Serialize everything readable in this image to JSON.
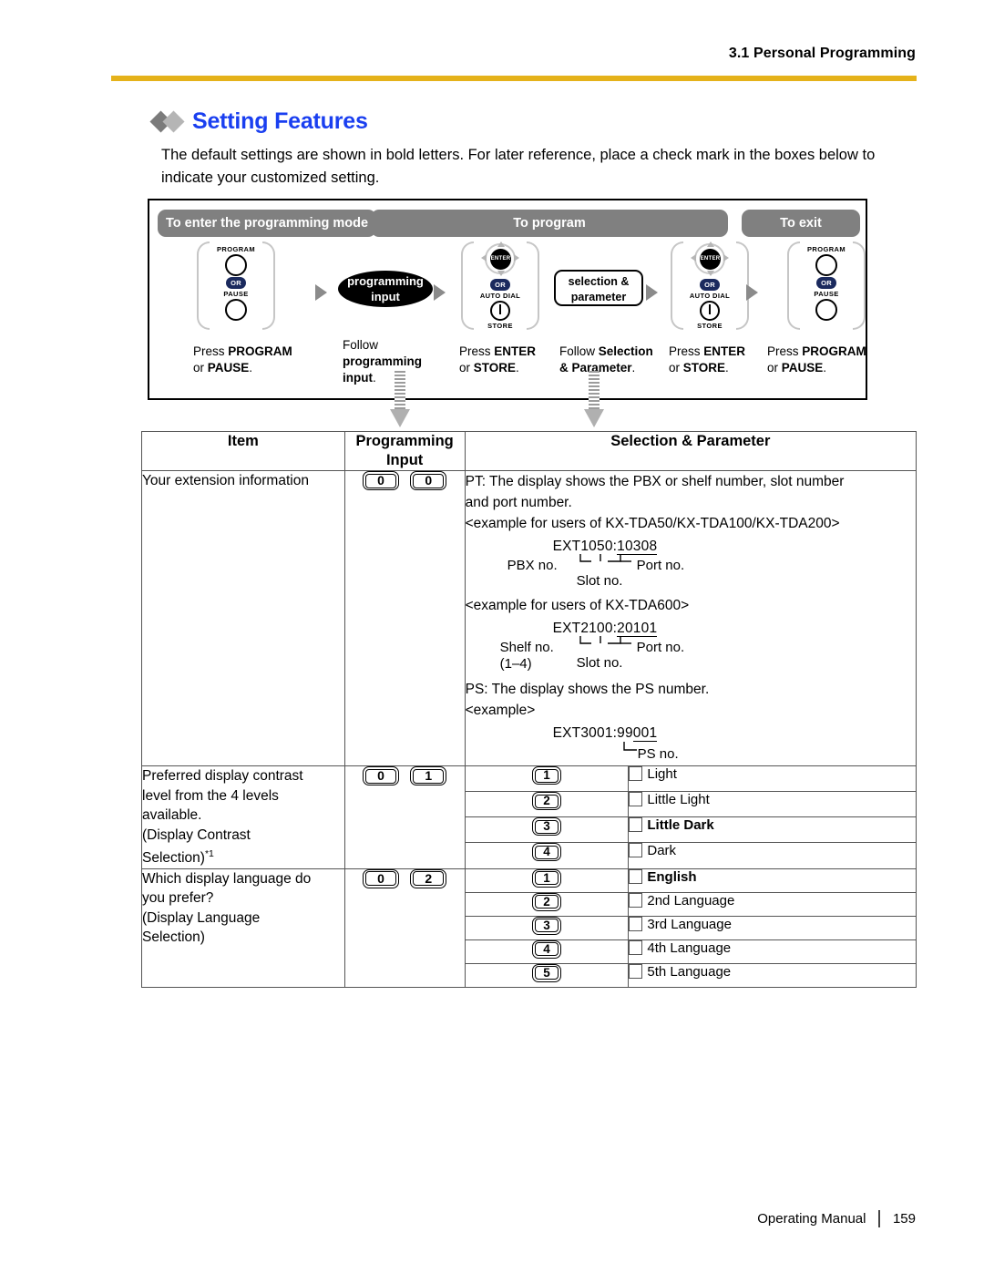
{
  "header": {
    "section": "3.1 Personal Programming",
    "rule_color": "#e5b21a"
  },
  "title": {
    "text": "Setting Features",
    "color": "#1a3ff0"
  },
  "intro": "The default settings are shown in bold letters. For later reference, place a check mark in the boxes below to indicate your customized setting.",
  "flow": {
    "bars": {
      "enter_mode": "To enter the programming mode",
      "to_program": "To program",
      "to_exit": "To exit"
    },
    "keys": {
      "program": "PROGRAM",
      "or": "OR",
      "pause": "PAUSE",
      "enter": "ENTER",
      "auto_dial": "AUTO DIAL",
      "store": "STORE"
    },
    "nodes": {
      "programming_input_l1": "programming",
      "programming_input_l2": "input",
      "selection_l1": "selection &",
      "selection_l2": "parameter"
    },
    "captions": {
      "c1_a": "Press ",
      "c1_b": "PROGRAM",
      "c1_c": "or ",
      "c1_d": "PAUSE",
      "c1_e": ".",
      "c2_a": "Follow",
      "c2_b": "programming",
      "c2_c": "input",
      "c2_d": ".",
      "c3_a": "Press ",
      "c3_b": "ENTER",
      "c3_c": "or ",
      "c3_d": "STORE",
      "c3_e": ".",
      "c4_a": "Follow ",
      "c4_b": "Selection",
      "c4_c": "& Parameter",
      "c4_d": ".",
      "c5_a": "Press ",
      "c5_b": "ENTER",
      "c5_c": "or ",
      "c5_d": "STORE",
      "c5_e": ".",
      "c6_a": "Press ",
      "c6_b": "PROGRAM",
      "c6_c": "or ",
      "c6_d": "PAUSE",
      "c6_e": "."
    }
  },
  "table": {
    "headers": {
      "item": "Item",
      "programming_input_l1": "Programming",
      "programming_input_l2": "Input",
      "selection_parameter": "Selection & Parameter"
    },
    "rows": [
      {
        "item": "Your extension information",
        "keys": [
          "0",
          "0"
        ],
        "detail": {
          "pt_line1": "PT: The display shows the PBX or shelf number, slot number",
          "pt_line2": "and port number.",
          "example1_label": "<example for users of KX-TDA50/KX-TDA100/KX-TDA200>",
          "example1_code_prefix": "EXT1050:",
          "example1_code_value": "10308",
          "example1_leader_left": "PBX no.",
          "example1_leader_mid": "Slot no.",
          "example1_leader_right": "Port no.",
          "example2_label": "<example for users of KX-TDA600>",
          "example2_code_prefix": "EXT2100:",
          "example2_code_value": "20101",
          "example2_leader_left": "Shelf no.",
          "example2_leader_left_sub": "(1–4)",
          "example2_leader_mid": "Slot no.",
          "example2_leader_right": "Port no.",
          "ps_line": "PS: The display shows the PS number.",
          "ps_example_label": "<example>",
          "ps_code_prefix": "EXT3001:99",
          "ps_code_value": "001",
          "ps_leader": "PS no."
        }
      },
      {
        "item_lines": [
          "Preferred display contrast",
          "level from the 4 levels",
          "available.",
          "(Display Contrast",
          "Selection)"
        ],
        "item_footnote": "*1",
        "keys": [
          "0",
          "1"
        ],
        "options": [
          {
            "key": "1",
            "label": "Light",
            "bold": false
          },
          {
            "key": "2",
            "label": "Little Light",
            "bold": false
          },
          {
            "key": "3",
            "label": "Little Dark",
            "bold": true
          },
          {
            "key": "4",
            "label": "Dark",
            "bold": false
          }
        ]
      },
      {
        "item_lines": [
          "Which display language do",
          "you prefer?",
          "(Display Language",
          "Selection)"
        ],
        "item_footnote": "",
        "keys": [
          "0",
          "2"
        ],
        "options": [
          {
            "key": "1",
            "label": "English",
            "bold": true
          },
          {
            "key": "2",
            "label": "2nd Language",
            "bold": false
          },
          {
            "key": "3",
            "label": "3rd Language",
            "bold": false
          },
          {
            "key": "4",
            "label": "4th Language",
            "bold": false
          },
          {
            "key": "5",
            "label": "5th Language",
            "bold": false
          }
        ]
      }
    ]
  },
  "footer": {
    "manual": "Operating Manual",
    "page": "159"
  }
}
